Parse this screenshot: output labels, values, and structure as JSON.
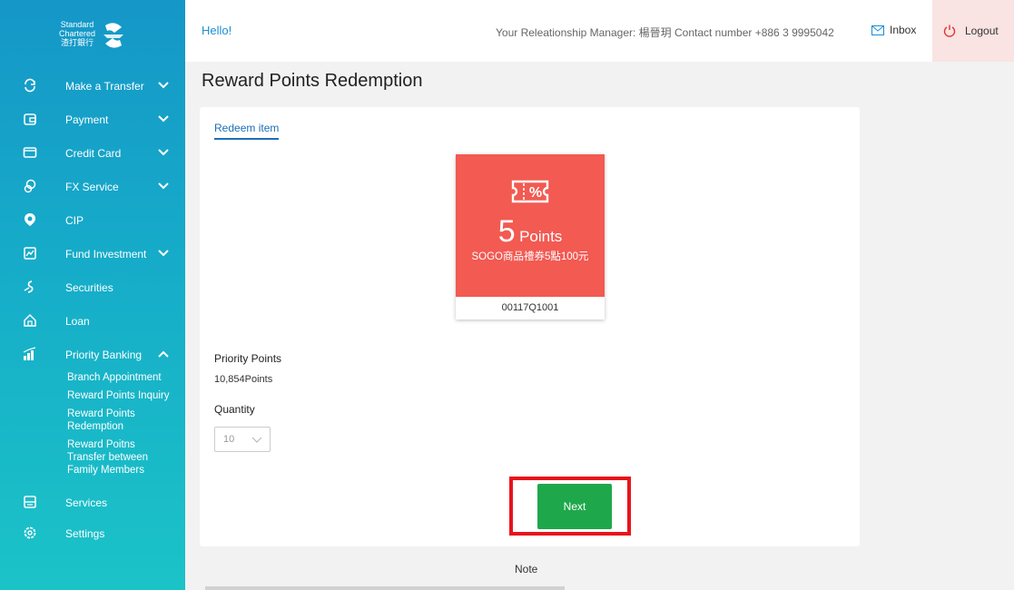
{
  "brand": {
    "logo_lines": [
      "Standard",
      "Chartered",
      "渣打銀行"
    ]
  },
  "sidebar": {
    "items": [
      {
        "label": "Make a Transfer",
        "icon": "transfer-icon",
        "expandable": true
      },
      {
        "label": "Payment",
        "icon": "wallet-icon",
        "expandable": true
      },
      {
        "label": "Credit Card",
        "icon": "credit-card-icon",
        "expandable": true
      },
      {
        "label": "FX Service",
        "icon": "fx-icon",
        "expandable": true
      },
      {
        "label": "CIP",
        "icon": "cip-icon",
        "expandable": false
      },
      {
        "label": "Fund Investment",
        "icon": "fund-icon",
        "expandable": true
      },
      {
        "label": "Securities",
        "icon": "securities-icon",
        "expandable": false
      },
      {
        "label": "Loan",
        "icon": "loan-icon",
        "expandable": false
      },
      {
        "label": "Priority Banking",
        "icon": "priority-banking-icon",
        "expandable": true,
        "expanded": true
      },
      {
        "label": "Services",
        "icon": "services-icon",
        "expandable": false
      },
      {
        "label": "Settings",
        "icon": "settings-icon",
        "expandable": false
      }
    ],
    "priority_sub": [
      "Branch Appointment",
      "Reward Points Inquiry",
      "Reward Points Redemption",
      "Reward Poitns Transfer between Family Members"
    ]
  },
  "header": {
    "greeting": "Hello!",
    "rm_text": "Your Releationship Manager: 楊晉玥 Contact number +886 3 9995042",
    "inbox_label": "Inbox",
    "logout_label": "Logout"
  },
  "page": {
    "title": "Reward Points Redemption",
    "tab_label": "Redeem item",
    "item": {
      "points_number": "5",
      "points_unit": "Points",
      "name": "SOGO商品禮券5點100元",
      "code": "00117Q1001"
    },
    "priority_points_label": "Priority Points",
    "priority_points_value": "10,854Points",
    "quantity_label": "Quantity",
    "quantity_value": "10",
    "next_label": "Next",
    "note_label": "Note"
  },
  "colors": {
    "sidebar_top": "#1597c8",
    "sidebar_bottom": "#1bc3c7",
    "item_red": "#f25a52",
    "next_green": "#1ea84b",
    "highlight_red": "#e8141b",
    "link_blue": "#1b8ed3"
  }
}
